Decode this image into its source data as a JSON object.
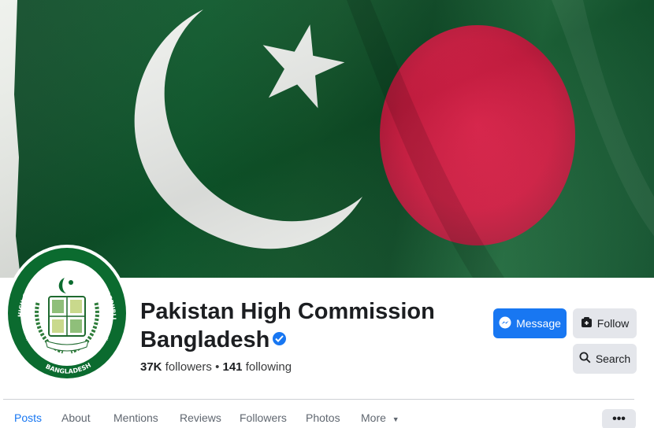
{
  "page": {
    "title": "Pakistan High Commission Bangladesh",
    "title_line1": "Pakistan High Commission",
    "title_line2": "Bangladesh",
    "verified": true,
    "followers": "37K",
    "followers_label": "followers",
    "separator": "•",
    "following": "141",
    "following_label": "following"
  },
  "avatar": {
    "seal_text_top": "HIGH COMMISSION OF THE ISLAMIC REPUBLIC OF PAKISTAN",
    "seal_text_bottom": "BANGLADESH"
  },
  "actions": {
    "message_label": "Message",
    "follow_label": "Follow",
    "search_label": "Search"
  },
  "tabs": [
    {
      "label": "Posts",
      "active": true
    },
    {
      "label": "About",
      "active": false
    },
    {
      "label": "Mentions",
      "active": false
    },
    {
      "label": "Reviews",
      "active": false
    },
    {
      "label": "Followers",
      "active": false
    },
    {
      "label": "Photos",
      "active": false
    },
    {
      "label": "More",
      "active": false
    }
  ],
  "more_options_label": "•••",
  "icons": {
    "messenger": "messenger-icon",
    "follow": "follow-icon",
    "search": "search-icon",
    "verified": "verified-badge-icon",
    "more_caret": "caret-down-icon"
  },
  "colors": {
    "brand_blue": "#1877f2",
    "pakistan_green": "#0d5a2c",
    "bangladesh_red": "#e0244a",
    "button_gray": "#e4e6eb"
  }
}
